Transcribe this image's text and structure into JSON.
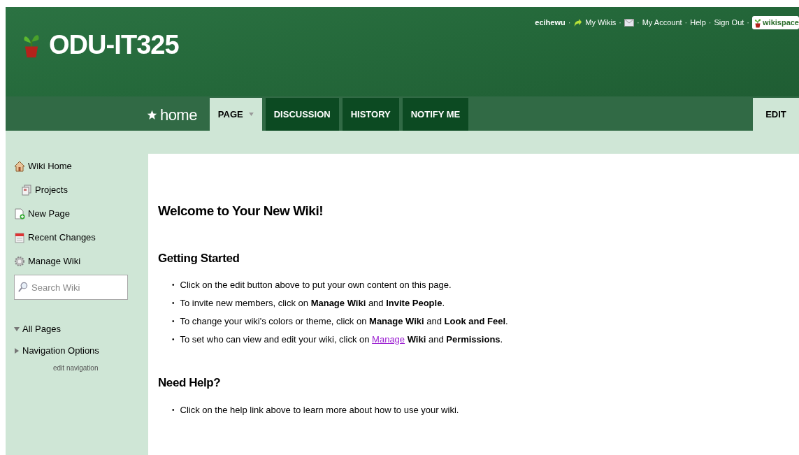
{
  "header": {
    "site_title": "ODU-IT325",
    "top_links": [
      {
        "kind": "text",
        "text": "ecihewu"
      },
      {
        "kind": "separator",
        "text": "·"
      },
      {
        "kind": "arrow-link",
        "text": "My Wikis"
      },
      {
        "kind": "separator",
        "text": "·"
      },
      {
        "kind": "mail"
      },
      {
        "kind": "separator",
        "text": "·"
      },
      {
        "kind": "link",
        "text": "My Account"
      },
      {
        "kind": "separator",
        "text": "·"
      },
      {
        "kind": "link",
        "text": "Help"
      },
      {
        "kind": "separator",
        "text": "·"
      },
      {
        "kind": "link",
        "text": "Sign Out"
      },
      {
        "kind": "separator",
        "text": "·"
      },
      {
        "kind": "logo",
        "text": "wikispace"
      }
    ]
  },
  "tabs": {
    "home": "home",
    "items": [
      {
        "label": "PAGE",
        "selected": true,
        "dropdown": true
      },
      {
        "label": "DISCUSSION",
        "selected": false,
        "dropdown": false
      },
      {
        "label": "HISTORY",
        "selected": false,
        "dropdown": false
      },
      {
        "label": "NOTIFY ME",
        "selected": false,
        "dropdown": false
      }
    ],
    "edit": "EDIT"
  },
  "sidebar": {
    "items": [
      {
        "kind": "home",
        "label": "Wiki Home",
        "indented": false
      },
      {
        "kind": "pages",
        "label": "Projects",
        "indented": true
      },
      {
        "kind": "new",
        "label": "New Page",
        "indented": false
      },
      {
        "kind": "changes",
        "label": "Recent Changes",
        "indented": false
      },
      {
        "kind": "manage",
        "label": "Manage Wiki",
        "indented": false
      }
    ],
    "search": {
      "placeholder": "Search Wiki"
    },
    "tree": [
      {
        "label": "All Pages",
        "expanded": true
      },
      {
        "label": "Navigation Options",
        "expanded": false
      }
    ],
    "edit_link": "edit navigation"
  },
  "content": {
    "title": "Welcome to Your New Wiki!",
    "sections": [
      {
        "heading": "Getting Started",
        "bullets": [
          {
            "marker": "•",
            "parts": [
              {
                "kind": "text",
                "text": "Click on the edit button above to put your own content on this page."
              }
            ]
          },
          {
            "marker": "•",
            "parts": [
              {
                "kind": "text",
                "text": "To invite new members, click on **Manage Wiki** and **Invite People**."
              }
            ]
          },
          {
            "marker": "•",
            "parts": [
              {
                "kind": "text",
                "text": "To change your wiki's colors or theme, click on **Manage Wiki** and **Look and Feel**."
              }
            ]
          },
          {
            "marker": "•",
            "parts": [
              {
                "kind": "text",
                "text": "To set who can view and edit your wiki, click on "
              },
              {
                "kind": "link",
                "text": "Manage"
              },
              {
                "kind": "text",
                "text": " **Wiki** and **Permissions**."
              }
            ]
          }
        ]
      },
      {
        "heading": "Need Help?",
        "bullets": [
          {
            "marker": "•",
            "parts": [
              {
                "kind": "text",
                "text": "Click on the help link above to learn more about how to use your wiki."
              }
            ]
          }
        ]
      }
    ]
  }
}
